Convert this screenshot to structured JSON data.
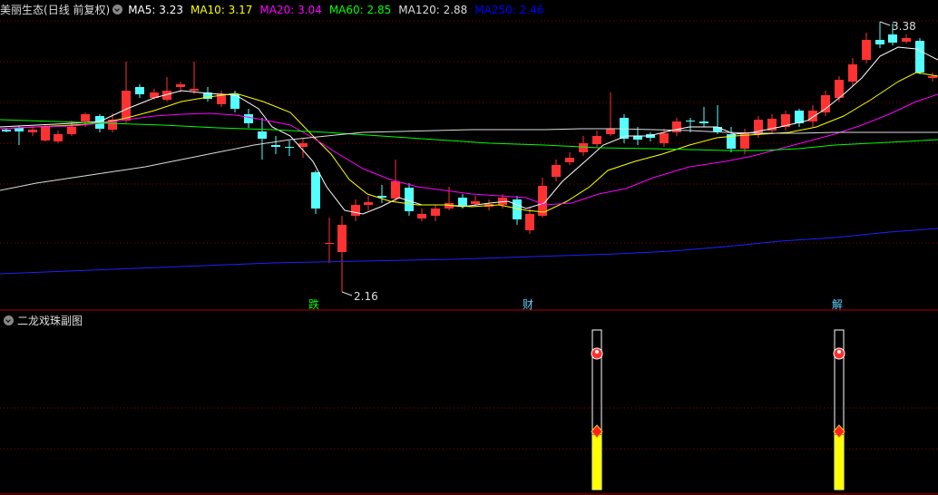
{
  "main_chart": {
    "stock_name": "美丽生态",
    "mode": "(日线 前复权)",
    "indicators": [
      {
        "label": "MA5:",
        "value": "3.23",
        "color": "#ffffff"
      },
      {
        "label": "MA10:",
        "value": "3.17",
        "color": "#ffff00"
      },
      {
        "label": "MA20:",
        "value": "3.04",
        "color": "#ff00ff"
      },
      {
        "label": "MA60:",
        "value": "2.85",
        "color": "#00ff00"
      },
      {
        "label": "MA120:",
        "value": "2.88",
        "color": "#dcdcdc"
      },
      {
        "label": "MA250:",
        "value": "2.46",
        "color": "#0000ff"
      }
    ],
    "high_label": "3.38",
    "low_label": "2.16",
    "markers": [
      {
        "text": "跌",
        "color": "#00ff00"
      },
      {
        "text": "财",
        "color": "#5fd0ff"
      },
      {
        "text": "解",
        "color": "#5fd0ff"
      }
    ]
  },
  "sub_chart": {
    "title": "二龙戏珠副图"
  },
  "colors": {
    "up": "#ff3232",
    "down": "#54ffff",
    "grid": "#8b0000",
    "yellow_bar": "#ffff00"
  }
}
